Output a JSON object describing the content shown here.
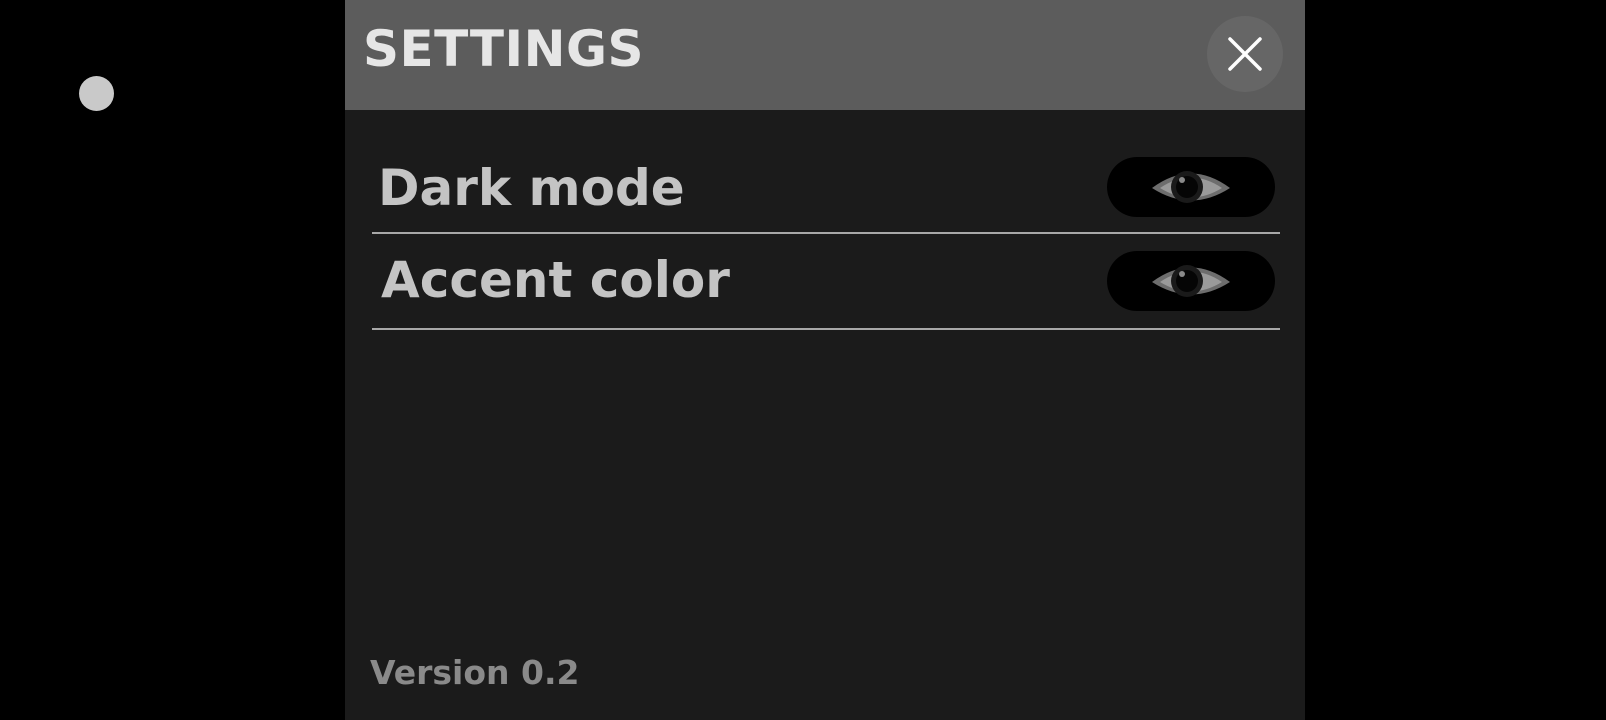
{
  "settings_panel": {
    "title": "SETTINGS",
    "close_icon": "close-icon",
    "items": [
      {
        "label": "Dark mode",
        "toggle_icon": "eye-icon"
      },
      {
        "label": "Accent color",
        "toggle_icon": "eye-icon"
      }
    ],
    "version": "Version 0.2"
  },
  "colors": {
    "header_background": "#5c5c5c",
    "panel_background": "#1b1b1b",
    "screen_background": "#000000",
    "title_text": "#e6e6e6",
    "label_text": "#c4c4c4",
    "version_text": "#8a8a8a"
  }
}
